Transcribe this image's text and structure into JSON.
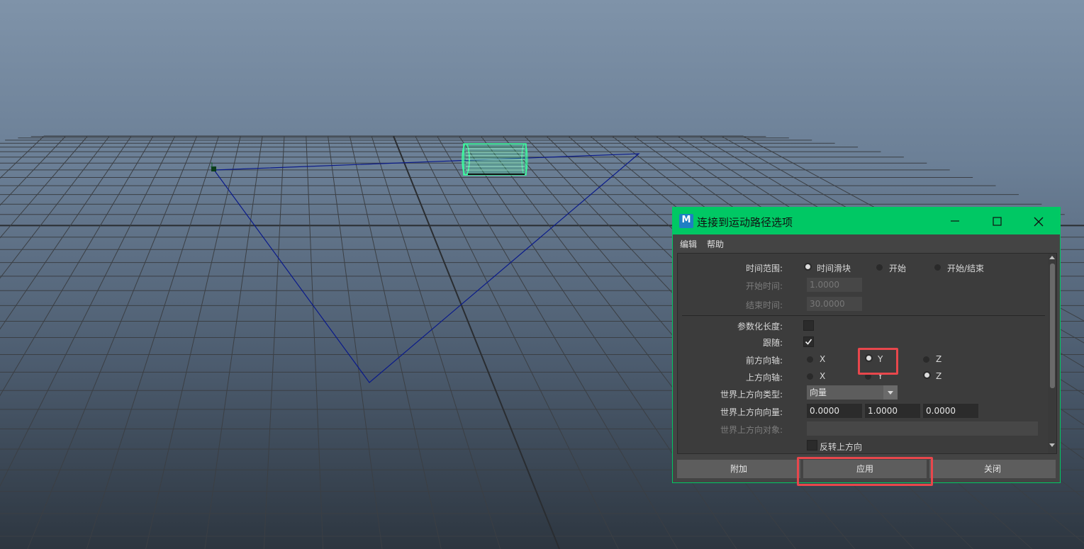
{
  "dialog": {
    "title": "连接到运动路径选项",
    "app_icon_letter": "M",
    "menu": [
      "编辑",
      "帮助"
    ],
    "time_range": {
      "label": "时间范围:",
      "options": [
        "时间滑块",
        "开始",
        "开始/结束"
      ],
      "selected": "时间滑块"
    },
    "start_time": {
      "label": "开始时间:",
      "value": "1.0000"
    },
    "end_time": {
      "label": "结束时间:",
      "value": "30.0000"
    },
    "parametric_length": {
      "label": "参数化长度:",
      "checked": false
    },
    "follow": {
      "label": "跟随:",
      "checked": true
    },
    "front_axis": {
      "label": "前方向轴:",
      "options": [
        "X",
        "Y",
        "Z"
      ],
      "selected": "Y"
    },
    "up_axis": {
      "label": "上方向轴:",
      "options": [
        "X",
        "Y",
        "Z"
      ],
      "selected": "Z"
    },
    "world_up_type": {
      "label": "世界上方向类型:",
      "value": "向量"
    },
    "world_up_vector": {
      "label": "世界上方向向量:",
      "values": [
        "0.0000",
        "1.0000",
        "0.0000"
      ]
    },
    "world_up_object": {
      "label": "世界上方向对象:",
      "value": ""
    },
    "inverse_up": {
      "label": "反转上方向",
      "checked": false
    },
    "buttons": {
      "add": "附加",
      "apply": "应用",
      "close": "关闭"
    }
  },
  "colors": {
    "titlebar": "#00c864",
    "highlight": "#e8474c",
    "path_curve": "#0a1a8a",
    "selected_object": "#3cffa0"
  }
}
